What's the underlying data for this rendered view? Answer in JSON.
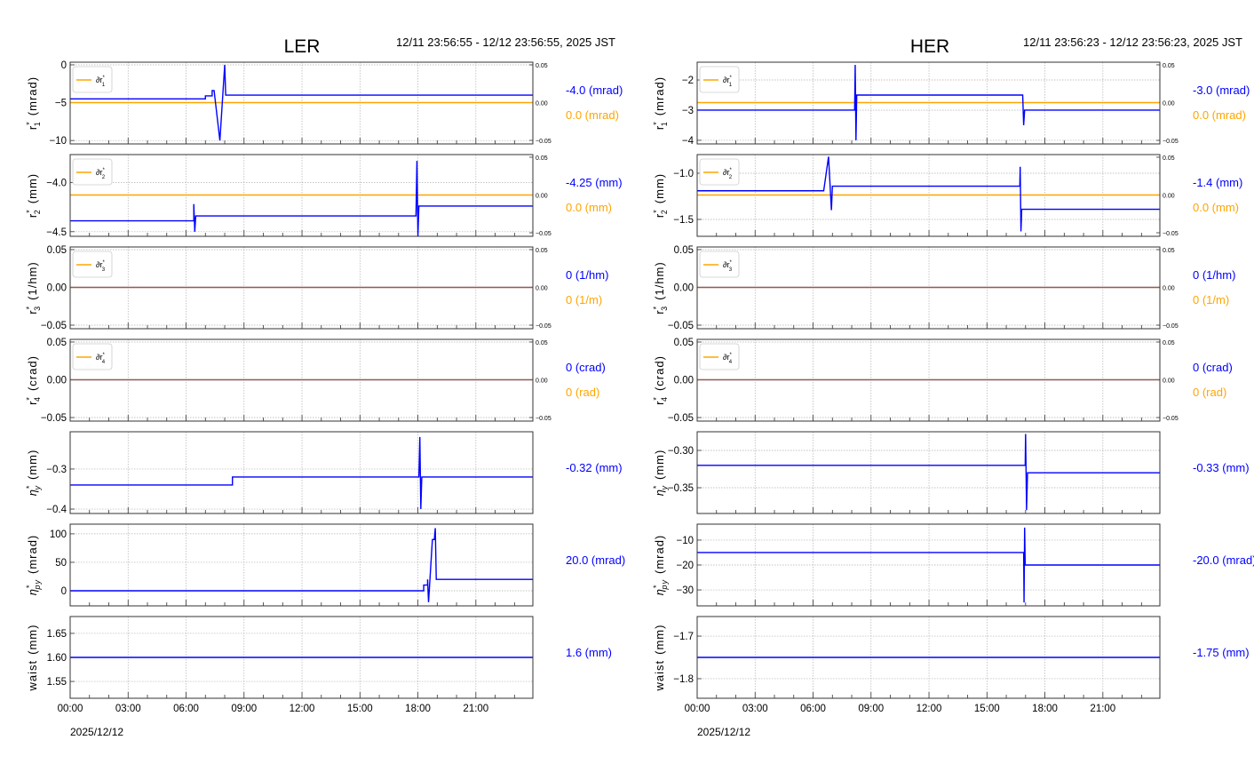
{
  "colors": {
    "series": "#0000ff",
    "reference": "#ffa500",
    "grid": "#b0b0b0",
    "frame": "#333333"
  },
  "chart_data": [
    {
      "type": "line",
      "title": "LER",
      "time_range": "12/11 23:56:55 - 12/12 23:56:55, 2025 JST",
      "xlim": [
        0,
        23.95
      ],
      "xticks": [
        0,
        3,
        6,
        9,
        12,
        15,
        18,
        21
      ],
      "xtick_labels": [
        "00:00",
        "03:00",
        "06:00",
        "09:00",
        "12:00",
        "15:00",
        "18:00",
        "21:00"
      ],
      "xlabel": "2025/12/12",
      "panels": [
        {
          "ylabel": {
            "base": "r",
            "sup": "*",
            "sub": "1",
            "unit": "(mrad)",
            "italic": false
          },
          "ylim": [
            -10.45,
            0.35
          ],
          "yticks": [
            0,
            -5,
            -10
          ],
          "ytick_labels": [
            "0",
            "−5",
            "−10"
          ],
          "right_ylim": [
            -0.0547,
            0.0535
          ],
          "right_yticks": [
            0.05,
            0,
            -0.05
          ],
          "right_ytick_labels": [
            "0.05",
            "0.00",
            "−0.05"
          ],
          "legend": {
            "base": "∂r",
            "sup": "*",
            "sub": "1"
          },
          "series": [
            [
              0,
              -4.5
            ],
            [
              7.0,
              -4.5
            ],
            [
              7.0,
              -4.1
            ],
            [
              7.35,
              -4.1
            ],
            [
              7.35,
              -3.4
            ],
            [
              7.45,
              -3.4
            ],
            [
              7.75,
              -10
            ],
            [
              8.0,
              0
            ],
            [
              8.05,
              -4.0
            ],
            [
              23.95,
              -4.0
            ]
          ],
          "reference": [
            [
              0,
              0
            ],
            [
              23.95,
              0
            ]
          ],
          "value": "-4.0 (mrad)",
          "ref_value": "0.0 (mrad)"
        },
        {
          "ylabel": {
            "base": "r",
            "sup": "*",
            "sub": "2",
            "unit": "(mm)",
            "italic": false
          },
          "ylim": [
            -4.547,
            -3.717
          ],
          "yticks": [
            -4.0,
            -4.5
          ],
          "ytick_labels": [
            "−4.0",
            "−4.5"
          ],
          "right_ylim": [
            -0.0547,
            0.0535
          ],
          "right_yticks": [
            0.05,
            0,
            -0.05
          ],
          "right_ytick_labels": [
            "0.05",
            "0.00",
            "−0.05"
          ],
          "legend": {
            "base": "∂r",
            "sup": "*",
            "sub": "2"
          },
          "series": [
            [
              0,
              -4.39
            ],
            [
              6.4,
              -4.39
            ],
            [
              6.4,
              -4.22
            ],
            [
              6.45,
              -4.5
            ],
            [
              6.5,
              -4.34
            ],
            [
              17.9,
              -4.34
            ],
            [
              17.95,
              -3.78
            ],
            [
              18.0,
              -4.55
            ],
            [
              18.05,
              -4.24
            ],
            [
              23.95,
              -4.24
            ]
          ],
          "reference": [
            [
              0,
              0
            ],
            [
              23.95,
              0
            ]
          ],
          "value": "-4.25 (mm)",
          "ref_value": "0.0 (mm)"
        },
        {
          "ylabel": {
            "base": "r",
            "sup": "*",
            "sub": "3",
            "unit": "(1/hm)",
            "italic": false
          },
          "ylim": [
            -0.0547,
            0.0535
          ],
          "yticks": [
            0.05,
            0,
            -0.05
          ],
          "ytick_labels": [
            "0.05",
            "0.00",
            "−0.05"
          ],
          "right_ylim": [
            -0.0547,
            0.0535
          ],
          "right_yticks": [
            0.05,
            0,
            -0.05
          ],
          "right_ytick_labels": [
            "0.05",
            "0.00",
            "−0.05"
          ],
          "legend": {
            "base": "∂r",
            "sup": "*",
            "sub": "3"
          },
          "series": [
            [
              0,
              0
            ],
            [
              23.95,
              0
            ]
          ],
          "reference": [
            [
              0,
              0
            ],
            [
              23.95,
              0
            ]
          ],
          "value": "0 (1/hm)",
          "ref_value": "0 (1/m)"
        },
        {
          "ylabel": {
            "base": "r",
            "sup": "*",
            "sub": "4",
            "unit": "(crad)",
            "italic": false
          },
          "ylim": [
            -0.0547,
            0.0535
          ],
          "yticks": [
            0.05,
            0,
            -0.05
          ],
          "ytick_labels": [
            "0.05",
            "0.00",
            "−0.05"
          ],
          "right_ylim": [
            -0.0547,
            0.0535
          ],
          "right_yticks": [
            0.05,
            0,
            -0.05
          ],
          "right_ytick_labels": [
            "0.05",
            "0.00",
            "−0.05"
          ],
          "legend": {
            "base": "∂r",
            "sup": "*",
            "sub": "4"
          },
          "series": [
            [
              0,
              0
            ],
            [
              23.95,
              0
            ]
          ],
          "reference": [
            [
              0,
              0
            ],
            [
              23.95,
              0
            ]
          ],
          "value": "0 (crad)",
          "ref_value": "0 (rad)"
        },
        {
          "ylabel": {
            "base": "η",
            "sup": "*",
            "sub": "y",
            "unit": "(mm)",
            "italic": true
          },
          "ylim": [
            -0.411,
            -0.207
          ],
          "yticks": [
            -0.3,
            -0.4
          ],
          "ytick_labels": [
            "−0.3",
            "−0.4"
          ],
          "series": [
            [
              0,
              -0.34
            ],
            [
              8.4,
              -0.34
            ],
            [
              8.4,
              -0.32
            ],
            [
              18.05,
              -0.32
            ],
            [
              18.1,
              -0.22
            ],
            [
              18.15,
              -0.4
            ],
            [
              18.2,
              -0.32
            ],
            [
              23.95,
              -0.32
            ]
          ],
          "value": "-0.32 (mm)"
        },
        {
          "ylabel": {
            "base": "η",
            "sup": "*",
            "sub": "py",
            "unit": "(mrad)",
            "italic": true
          },
          "ylim": [
            -26.5,
            117
          ],
          "yticks": [
            100,
            50,
            0
          ],
          "ytick_labels": [
            "100",
            "50",
            "0"
          ],
          "series": [
            [
              0,
              0
            ],
            [
              18.3,
              0
            ],
            [
              18.3,
              10
            ],
            [
              18.5,
              10
            ],
            [
              18.5,
              20
            ],
            [
              18.55,
              -20
            ],
            [
              18.75,
              90
            ],
            [
              18.85,
              90
            ],
            [
              18.9,
              110
            ],
            [
              18.95,
              20
            ],
            [
              23.95,
              20
            ]
          ],
          "value": "20.0 (mrad)"
        },
        {
          "ylabel": {
            "base": "waist",
            "sup": "",
            "sub": "",
            "unit": "(mm)",
            "italic": false
          },
          "ylim": [
            1.515,
            1.685
          ],
          "yticks": [
            1.65,
            1.6,
            1.55
          ],
          "ytick_labels": [
            "1.65",
            "1.60",
            "1.55"
          ],
          "series": [
            [
              0,
              1.6
            ],
            [
              23.95,
              1.6
            ]
          ],
          "value": "1.6 (mm)"
        }
      ]
    },
    {
      "type": "line",
      "title": "HER",
      "time_range": "12/11 23:56:23 - 12/12 23:56:23, 2025 JST",
      "xlim": [
        0,
        23.95
      ],
      "xticks": [
        0,
        3,
        6,
        9,
        12,
        15,
        18,
        21
      ],
      "xtick_labels": [
        "00:00",
        "03:00",
        "06:00",
        "09:00",
        "12:00",
        "15:00",
        "18:00",
        "21:00"
      ],
      "xlabel": "2025/12/12",
      "panels": [
        {
          "ylabel": {
            "base": "r",
            "sup": "*",
            "sub": "1",
            "unit": "(mrad)",
            "italic": false
          },
          "ylim": [
            -4.12,
            -1.41
          ],
          "yticks": [
            -2,
            -3,
            -4
          ],
          "ytick_labels": [
            "−2",
            "−3",
            "−4"
          ],
          "right_ylim": [
            -0.0547,
            0.0535
          ],
          "right_yticks": [
            0.05,
            0,
            -0.05
          ],
          "right_ytick_labels": [
            "0.05",
            "0.00",
            "−0.05"
          ],
          "legend": {
            "base": "∂r",
            "sup": "*",
            "sub": "1"
          },
          "series": [
            [
              0,
              -3.0
            ],
            [
              8.15,
              -3.0
            ],
            [
              8.18,
              -1.5
            ],
            [
              8.22,
              -4.0
            ],
            [
              8.26,
              -2.5
            ],
            [
              16.85,
              -2.5
            ],
            [
              16.9,
              -3.5
            ],
            [
              16.95,
              -3.0
            ],
            [
              23.95,
              -3.0
            ]
          ],
          "reference": [
            [
              0,
              0
            ],
            [
              23.95,
              0
            ]
          ],
          "value": "-3.0 (mrad)",
          "ref_value": "0.0 (mrad)"
        },
        {
          "ylabel": {
            "base": "r",
            "sup": "*",
            "sub": "2",
            "unit": "(mm)",
            "italic": false
          },
          "ylim": [
            -1.683,
            -0.798
          ],
          "yticks": [
            -1.0,
            -1.5
          ],
          "ytick_labels": [
            "−1.0",
            "−1.5"
          ],
          "right_ylim": [
            -0.0547,
            0.0535
          ],
          "right_yticks": [
            0.05,
            0,
            -0.05
          ],
          "right_ytick_labels": [
            "0.05",
            "0.00",
            "−0.05"
          ],
          "legend": {
            "base": "∂r",
            "sup": "*",
            "sub": "2"
          },
          "series": [
            [
              0,
              -1.19
            ],
            [
              6.55,
              -1.19
            ],
            [
              6.8,
              -0.82
            ],
            [
              6.95,
              -1.4
            ],
            [
              7.0,
              -1.14
            ],
            [
              16.7,
              -1.14
            ],
            [
              16.72,
              -0.93
            ],
            [
              16.76,
              -1.63
            ],
            [
              16.8,
              -1.39
            ],
            [
              23.95,
              -1.39
            ]
          ],
          "reference": [
            [
              0,
              0
            ],
            [
              23.95,
              0
            ]
          ],
          "value": "-1.4 (mm)",
          "ref_value": "0.0 (mm)"
        },
        {
          "ylabel": {
            "base": "r",
            "sup": "*",
            "sub": "3",
            "unit": "(1/hm)",
            "italic": false
          },
          "ylim": [
            -0.0547,
            0.0535
          ],
          "yticks": [
            0.05,
            0,
            -0.05
          ],
          "ytick_labels": [
            "0.05",
            "0.00",
            "−0.05"
          ],
          "right_ylim": [
            -0.0547,
            0.0535
          ],
          "right_yticks": [
            0.05,
            0,
            -0.05
          ],
          "right_ytick_labels": [
            "0.05",
            "0.00",
            "−0.05"
          ],
          "legend": {
            "base": "∂r",
            "sup": "*",
            "sub": "3"
          },
          "series": [
            [
              0,
              0
            ],
            [
              23.95,
              0
            ]
          ],
          "reference": [
            [
              0,
              0
            ],
            [
              23.95,
              0
            ]
          ],
          "value": "0 (1/hm)",
          "ref_value": "0 (1/m)"
        },
        {
          "ylabel": {
            "base": "r",
            "sup": "*",
            "sub": "4",
            "unit": "(crad)",
            "italic": false
          },
          "ylim": [
            -0.0547,
            0.0535
          ],
          "yticks": [
            0.05,
            0,
            -0.05
          ],
          "ytick_labels": [
            "0.05",
            "0.00",
            "−0.05"
          ],
          "right_ylim": [
            -0.0547,
            0.0535
          ],
          "right_yticks": [
            0.05,
            0,
            -0.05
          ],
          "right_ytick_labels": [
            "0.05",
            "0.00",
            "−0.05"
          ],
          "legend": {
            "base": "∂r",
            "sup": "*",
            "sub": "4"
          },
          "series": [
            [
              0,
              0
            ],
            [
              23.95,
              0
            ]
          ],
          "reference": [
            [
              0,
              0
            ],
            [
              23.95,
              0
            ]
          ],
          "value": "0 (crad)",
          "ref_value": "0 (rad)"
        },
        {
          "ylabel": {
            "base": "η",
            "sup": "*",
            "sub": "y",
            "unit": "(mm)",
            "italic": true
          },
          "ylim": [
            -0.3845,
            -0.275
          ],
          "yticks": [
            -0.3,
            -0.35
          ],
          "ytick_labels": [
            "−0.30",
            "−0.35"
          ],
          "series": [
            [
              0,
              -0.32
            ],
            [
              16.98,
              -0.32
            ],
            [
              17.0,
              -0.278
            ],
            [
              17.05,
              -0.38
            ],
            [
              17.1,
              -0.33
            ],
            [
              23.95,
              -0.33
            ]
          ],
          "value": "-0.33 (mm)"
        },
        {
          "ylabel": {
            "base": "η",
            "sup": "*",
            "sub": "py",
            "unit": "(mrad)",
            "italic": true
          },
          "ylim": [
            -36.4,
            -3.6
          ],
          "yticks": [
            -10,
            -20,
            -30
          ],
          "ytick_labels": [
            "−10",
            "−20",
            "−30"
          ],
          "series": [
            [
              0,
              -15
            ],
            [
              16.9,
              -15
            ],
            [
              16.92,
              -35
            ],
            [
              16.95,
              -5
            ],
            [
              16.98,
              -20
            ],
            [
              23.95,
              -20
            ]
          ],
          "value": "-20.0 (mrad)"
        },
        {
          "ylabel": {
            "base": "waist",
            "sup": "",
            "sub": "",
            "unit": "(mm)",
            "italic": false
          },
          "ylim": [
            -1.846,
            -1.654
          ],
          "yticks": [
            -1.7,
            -1.8
          ],
          "ytick_labels": [
            "−1.7",
            "−1.8"
          ],
          "series": [
            [
              0,
              -1.75
            ],
            [
              23.95,
              -1.75
            ]
          ],
          "value": "-1.75 (mm)"
        }
      ]
    }
  ]
}
